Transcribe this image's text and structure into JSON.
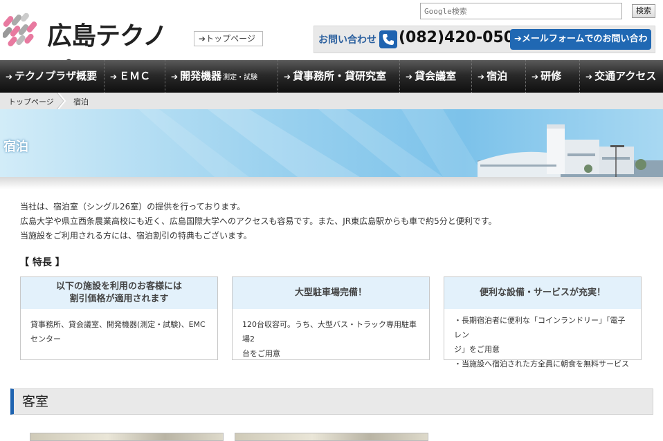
{
  "header": {
    "logo_text": "広島テクノプラザ",
    "top_link": "トップページ",
    "search_placeholder": "Google検索",
    "search_button": "検索",
    "contact_label": "お問い合わせ",
    "phone": "(082)420-0500",
    "mail_button": "メールフォームでのお問い合わせ"
  },
  "nav": {
    "items": [
      {
        "label": "テクノプラザ概要"
      },
      {
        "label": "ＥＭＣ"
      },
      {
        "label": "開発機器",
        "sub": "測定・試験"
      },
      {
        "label": "貸事務所・貸研究室"
      },
      {
        "label": "貸会議室"
      },
      {
        "label": "宿泊"
      },
      {
        "label": "研修"
      },
      {
        "label": "交通アクセス"
      }
    ]
  },
  "breadcrumb": {
    "home": "トップページ",
    "current": "宿泊"
  },
  "banner": {
    "title": "宿泊"
  },
  "intro": {
    "lines": [
      "当社は、宿泊室（シングル26室）の提供を行っております。",
      "広島大学や県立西条農業高校にも近く、広島国際大学へのアクセスも容易です。また、JR東広島駅からも車で約5分と便利です。",
      "当施設をご利用される方には、宿泊割引の特典もございます。"
    ]
  },
  "features": {
    "heading": "【 特長 】",
    "cards": [
      {
        "title_lines": [
          "以下の施設を利用のお客様には",
          "割引価格が適用されます"
        ],
        "body_lines": [
          "貸事務所、貸会議室、開発機器(測定・試験)、EMC",
          "センター"
        ]
      },
      {
        "title_lines": [
          "大型駐車場完備！"
        ],
        "body_lines": [
          "120台収容可。うち、大型バス・トラック専用駐車場2",
          "台をご用意"
        ]
      },
      {
        "title_lines": [
          "便利な設備・サービスが充実！"
        ],
        "body_lines": [
          "・長期宿泊者に便利な「コインランドリー」「電子レン",
          "ジ」をご用意",
          "・当施設へ宿泊された方全員に朝食を無料サービス"
        ]
      }
    ]
  },
  "rooms": {
    "title": "客室"
  },
  "colors": {
    "accent": "#1e63b0",
    "nav_bg": "#1a1a1a",
    "card_head_bg": "#e3f1fb"
  }
}
